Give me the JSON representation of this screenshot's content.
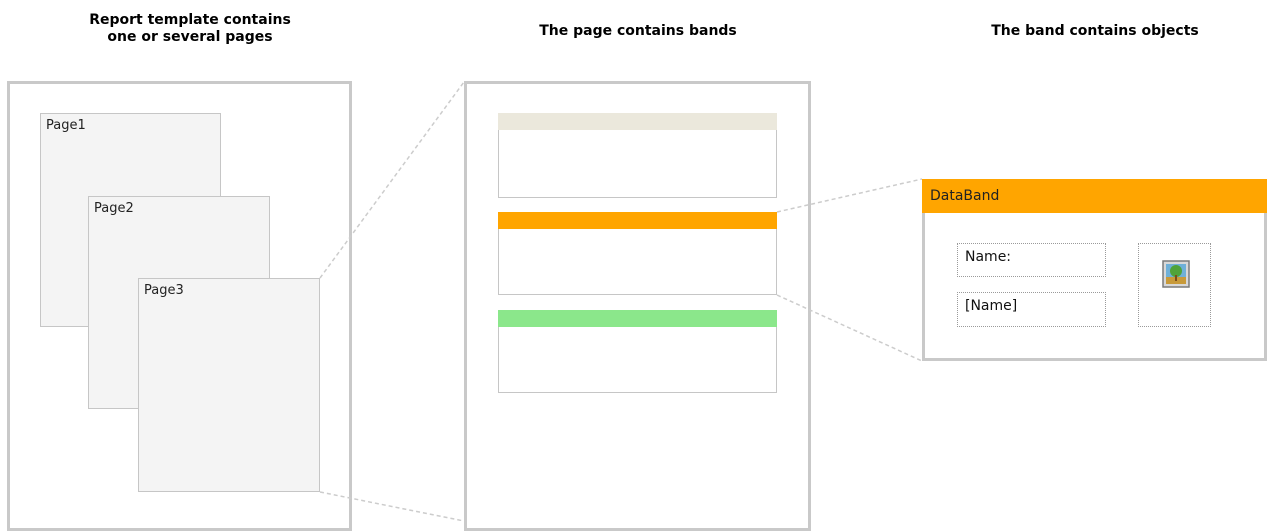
{
  "headings": {
    "report": "Report template contains\none or several pages",
    "page": "The page contains bands",
    "band": "The band contains objects"
  },
  "pages": [
    {
      "label": "Page1"
    },
    {
      "label": "Page2"
    },
    {
      "label": "Page3"
    }
  ],
  "bands": [
    {
      "header_color": "#ebe8dc"
    },
    {
      "header_color": "#ffa500"
    },
    {
      "header_color": "#8be78b"
    }
  ],
  "databand": {
    "title": "DataBand",
    "header_color": "#ffa500",
    "fields": {
      "label": "Name:",
      "value": "[Name]"
    },
    "picture_icon": "image-icon"
  },
  "colors": {
    "frame_border": "#c9c9c9",
    "connector": "#cccccc",
    "page_fill": "#f4f4f4"
  }
}
